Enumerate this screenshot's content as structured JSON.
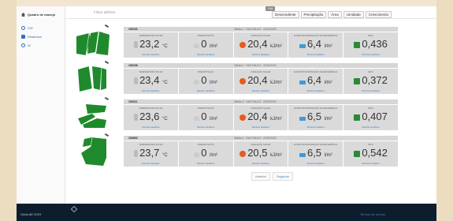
{
  "sidebar": {
    "title": "Quadro de manejo",
    "items": [
      {
        "label": "SIG"
      },
      {
        "label": "Relatórios"
      },
      {
        "label": "IA"
      }
    ]
  },
  "toolbar": {
    "filter_placeholder": "Filtrar talhões",
    "sort_label": "Ord",
    "sort_buttons": [
      "Descendente",
      "Precipitação",
      "Área",
      "Umidade",
      "Crescimento"
    ]
  },
  "metric_labels": {
    "temp": "Temperatura do ar",
    "precip": "Precipitação",
    "rad": "Radiação solar",
    "evap": "Evapotranspiração de referência",
    "ndvi": "NDVI"
  },
  "link_label": "Mostrar detalhes",
  "fields": [
    {
      "name": "100101",
      "meta": "Talhão 1 · SAO PAULO · 22/02/2020",
      "temp": "23,2",
      "temp_unit": "°C",
      "precip": "0",
      "precip_unit": "l/m²",
      "rad": "20,4",
      "rad_unit": "kJ/m²",
      "evap": "6,4",
      "evap_unit": "l/m²",
      "ndvi": "0,436"
    },
    {
      "name": "100106",
      "meta": "Talhão 2 · SAO PAULO · 22/02/2020",
      "temp": "23,4",
      "temp_unit": "°C",
      "precip": "0",
      "precip_unit": "l/m²",
      "rad": "20,4",
      "rad_unit": "kJ/m²",
      "evap": "6,4",
      "evap_unit": "l/m²",
      "ndvi": "0,372"
    },
    {
      "name": "100111",
      "meta": "Talhão 3 · SAO PAULO · 22/02/2020",
      "temp": "23,6",
      "temp_unit": "°C",
      "precip": "0",
      "precip_unit": "l/m²",
      "rad": "20,4",
      "rad_unit": "kJ/m²",
      "evap": "6,5",
      "evap_unit": "l/m²",
      "ndvi": "0,407"
    },
    {
      "name": "100602",
      "meta": "Talhão 4 · SAO PAULO · 22/02/2020",
      "temp": "23,7",
      "temp_unit": "°C",
      "precip": "0",
      "precip_unit": "l/m²",
      "rad": "20,5",
      "rad_unit": "kJ/m²",
      "evap": "6,5",
      "evap_unit": "l/m²",
      "ndvi": "0,542"
    }
  ],
  "pager": {
    "prev": "Anterior",
    "next": "Seguinte"
  },
  "footer": {
    "left": "Ondo AE 2019",
    "right": "Termos de serviço"
  },
  "colors": {
    "field_green": "#1f8a2c",
    "accent_blue": "#3a7fc1",
    "footer_bg": "#0c1e2e"
  }
}
